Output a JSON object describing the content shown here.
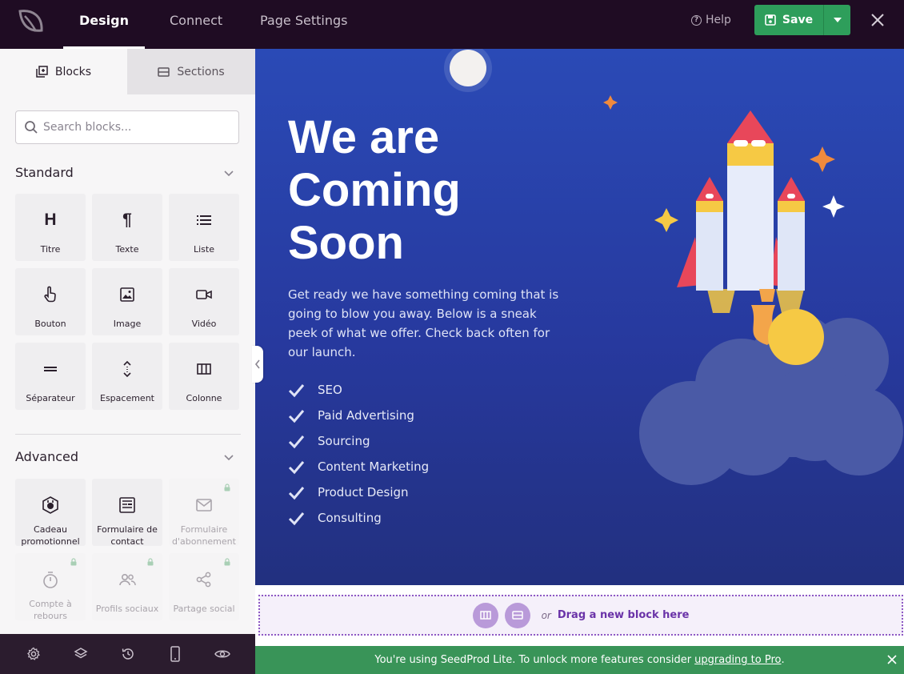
{
  "topbar": {
    "tabs": [
      "Design",
      "Connect",
      "Page Settings"
    ],
    "help_label": "Help",
    "save_label": "Save"
  },
  "sidebar": {
    "tabs": [
      "Blocks",
      "Sections"
    ],
    "search_placeholder": "Search blocks...",
    "standard": {
      "title": "Standard",
      "blocks": [
        "Titre",
        "Texte",
        "Liste",
        "Bouton",
        "Image",
        "Vidéo",
        "Séparateur",
        "Espacement",
        "Colonne"
      ]
    },
    "advanced": {
      "title": "Advanced",
      "blocks": [
        "Cadeau promotionnel",
        "Formulaire de contact",
        "Formulaire d'abonnement",
        "Compte à rebours",
        "Profils sociaux",
        "Partage social"
      ]
    }
  },
  "hero": {
    "title": "We are Coming Soon",
    "description": "Get ready we have something coming that is going to blow you away. Below is a sneak peek of what we offer. Check back often for our launch.",
    "features": [
      "SEO",
      "Paid Advertising",
      "Sourcing",
      "Content Marketing",
      "Product Design",
      "Consulting"
    ]
  },
  "dropzone": {
    "or_label": "or",
    "text": "Drag a new block here"
  },
  "notice": {
    "text": "You're using SeedProd Lite. To unlock more features consider",
    "link": "upgrading to Pro",
    "suffix": "."
  },
  "colors": {
    "topbar": "#1f0c23",
    "save_green": "#2e9e5b",
    "hero_blue": "#2a4ab6",
    "accent_purple": "#6a33a8",
    "notice_green": "#399458"
  }
}
